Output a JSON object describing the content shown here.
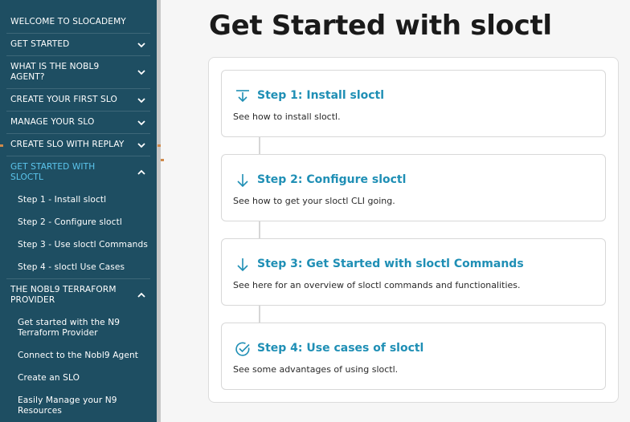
{
  "sidebar": {
    "items": [
      {
        "label": "WELCOME TO SLOCADEMY",
        "chevron": "none"
      },
      {
        "label": "GET STARTED",
        "chevron": "down"
      },
      {
        "label": "WHAT IS THE NOBL9 AGENT?",
        "chevron": "down"
      },
      {
        "label": "CREATE YOUR FIRST SLO",
        "chevron": "down"
      },
      {
        "label": "MANAGE YOUR SLO",
        "chevron": "down"
      },
      {
        "label": "CREATE SLO WITH REPLAY",
        "chevron": "down"
      },
      {
        "label": "GET STARTED WITH SLOCTL",
        "chevron": "up",
        "active": true
      },
      {
        "label": "Step 1 - Install sloctl",
        "sub": true
      },
      {
        "label": "Step 2 - Configure sloctl",
        "sub": true
      },
      {
        "label": "Step 3 - Use sloctl Commands",
        "sub": true
      },
      {
        "label": "Step 4 - sloctl Use Cases",
        "sub": true
      },
      {
        "label": "THE NOBL9 TERRAFORM PROVIDER",
        "chevron": "up"
      },
      {
        "label": "Get started with the N9 Terraform Provider",
        "sub": true
      },
      {
        "label": "Connect to the Nobl9 Agent",
        "sub": true
      },
      {
        "label": "Create an SLO",
        "sub": true
      },
      {
        "label": "Easily Manage your N9 Resources",
        "sub": true
      }
    ]
  },
  "main": {
    "title": "Get Started with sloctl",
    "steps": [
      {
        "title": "Step 1: Install sloctl",
        "description": "See how to install sloctl.",
        "icon": "download-arrow-icon"
      },
      {
        "title": "Step 2: Configure sloctl",
        "description": "See how to get your sloctl CLI going.",
        "icon": "arrow-down-icon"
      },
      {
        "title": "Step 3: Get Started with sloctl Commands",
        "description": "See here for an overview of sloctl commands and functionalities.",
        "icon": "arrow-down-icon"
      },
      {
        "title": "Step 4: Use cases of sloctl",
        "description": "See some advantages of using sloctl.",
        "icon": "check-circle-icon"
      }
    ]
  },
  "colors": {
    "sidebar_bg": "#1e4e62",
    "active_link": "#5cc6ee",
    "step_title": "#1f8fb5"
  }
}
